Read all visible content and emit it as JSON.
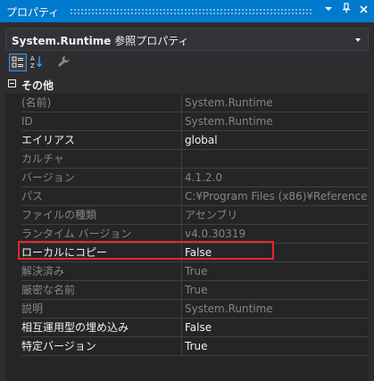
{
  "window": {
    "title": "プロパティ",
    "dropdown_glyph": "▾",
    "pin_glyph": "ᵖ",
    "close_glyph": "✕"
  },
  "object_selector": {
    "object_name": "System.Runtime",
    "object_type": "参照プロパティ"
  },
  "toolbar": {
    "categorized_icon": "categorized-icon",
    "alphabetical_icon": "sort-alphabetical-icon",
    "property_pages_icon": "wrench-icon"
  },
  "grid": {
    "category": "その他",
    "rows": [
      {
        "name": "(名前)",
        "value": "System.Runtime",
        "readonly": true
      },
      {
        "name": "ID",
        "value": "System.Runtime",
        "readonly": true
      },
      {
        "name": "エイリアス",
        "value": "global",
        "readonly": false
      },
      {
        "name": "カルチャ",
        "value": "",
        "readonly": true
      },
      {
        "name": "バージョン",
        "value": "4.1.2.0",
        "readonly": true
      },
      {
        "name": "パス",
        "value": "C:¥Program Files (x86)¥Reference",
        "readonly": true
      },
      {
        "name": "ファイルの種類",
        "value": "アセンブリ",
        "readonly": true
      },
      {
        "name": "ランタイム バージョン",
        "value": "v4.0.30319",
        "readonly": true
      },
      {
        "name": "ローカルにコピー",
        "value": "False",
        "readonly": false
      },
      {
        "name": "解決済み",
        "value": "True",
        "readonly": true
      },
      {
        "name": "厳密な名前",
        "value": "True",
        "readonly": true
      },
      {
        "name": "説明",
        "value": "System.Runtime",
        "readonly": true
      },
      {
        "name": "相互運用型の埋め込み",
        "value": "False",
        "readonly": false
      },
      {
        "name": "特定バージョン",
        "value": "True",
        "readonly": false
      }
    ]
  },
  "colors": {
    "titlebar": "#007acc",
    "background": "#2d2d30",
    "grid_background": "#252526",
    "readonly_text": "#858585",
    "editable_text": "#f1f1f1",
    "annotation": "#e8262b"
  }
}
